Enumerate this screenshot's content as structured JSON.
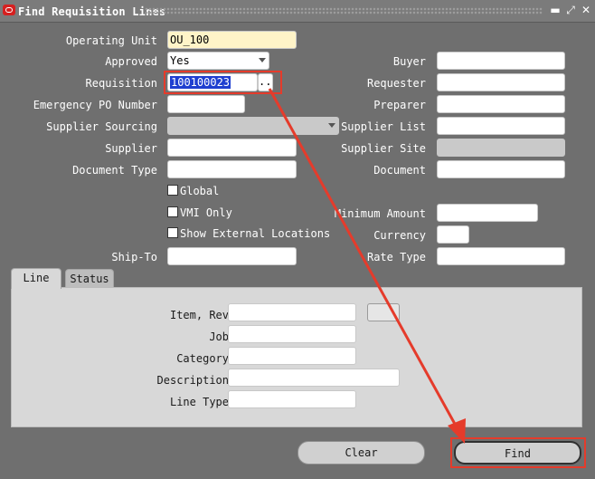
{
  "window": {
    "title": "Find Requisition Lines",
    "logo_icon": "oracle-logo-icon",
    "controls": [
      "minimize-icon",
      "maximize-icon",
      "close-icon"
    ]
  },
  "form": {
    "operating_unit": {
      "label": "Operating Unit",
      "value": "OU_100"
    },
    "approved": {
      "label": "Approved",
      "value": "Yes"
    },
    "requisition": {
      "label": "Requisition",
      "value": "100100023",
      "lov_label": "..."
    },
    "emergency_po": {
      "label": "Emergency PO Number",
      "value": ""
    },
    "supplier_sourcing": {
      "label": "Supplier Sourcing",
      "value": ""
    },
    "supplier": {
      "label": "Supplier",
      "value": ""
    },
    "document_type": {
      "label": "Document Type",
      "value": ""
    },
    "buyer": {
      "label": "Buyer",
      "value": ""
    },
    "requester": {
      "label": "Requester",
      "value": ""
    },
    "preparer": {
      "label": "Preparer",
      "value": ""
    },
    "supplier_list": {
      "label": "Supplier List",
      "value": ""
    },
    "supplier_site": {
      "label": "Supplier Site",
      "value": ""
    },
    "document": {
      "label": "Document",
      "value": ""
    },
    "global": {
      "label": "Global",
      "checked": false
    },
    "vmi_only": {
      "label": "VMI Only",
      "checked": false
    },
    "show_external": {
      "label": "Show External Locations",
      "checked": false
    },
    "minimum_amount": {
      "label": "Minimum Amount",
      "value": ""
    },
    "currency": {
      "label": "Currency",
      "value": ""
    },
    "ship_to": {
      "label": "Ship-To",
      "value": ""
    },
    "rate_type": {
      "label": "Rate Type",
      "value": ""
    }
  },
  "tabs": [
    {
      "label": "Line",
      "active": true
    },
    {
      "label": "Status",
      "active": false
    }
  ],
  "line_tab": {
    "item_rev": {
      "label": "Item, Rev",
      "value": "",
      "rev": ""
    },
    "job": {
      "label": "Job",
      "value": ""
    },
    "category": {
      "label": "Category",
      "value": ""
    },
    "description": {
      "label": "Description",
      "value": ""
    },
    "line_type": {
      "label": "Line Type",
      "value": ""
    }
  },
  "buttons": {
    "clear": "Clear",
    "find": "Find"
  },
  "colors": {
    "background": "#6f6f6f",
    "highlight": "#e53b2b",
    "selection": "#1f3fd0"
  }
}
